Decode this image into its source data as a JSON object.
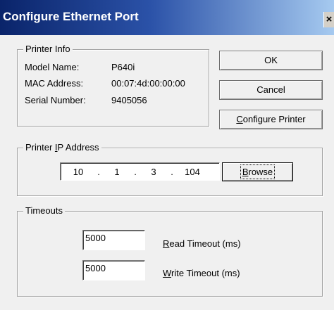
{
  "window": {
    "title": "Configure Ethernet Port",
    "close_glyph": "×"
  },
  "printer_info": {
    "legend": "Printer Info",
    "model_label": "Model Name:",
    "model_value": "P640i",
    "mac_label": "MAC Address:",
    "mac_value": "00:07:4d:00:00:00",
    "serial_label": "Serial Number:",
    "serial_value": "9405056"
  },
  "buttons": {
    "ok": "OK",
    "cancel": "Cancel",
    "configure_printer_accel": "C",
    "configure_printer_rest": "onfigure Printer",
    "browse_accel": "B",
    "browse_rest": "rowse"
  },
  "ip_address": {
    "legend_pre": "Printer ",
    "legend_accel": "I",
    "legend_post": "P Address",
    "octets": [
      "10",
      "1",
      "3",
      "104"
    ],
    "separator": "."
  },
  "timeouts": {
    "legend": "Timeouts",
    "read_value": "5000",
    "read_accel": "R",
    "read_label_rest": "ead Timeout (ms)",
    "write_value": "5000",
    "write_accel": "W",
    "write_label_rest": "rite Timeout (ms)"
  },
  "icons": {
    "close": "close-icon"
  }
}
